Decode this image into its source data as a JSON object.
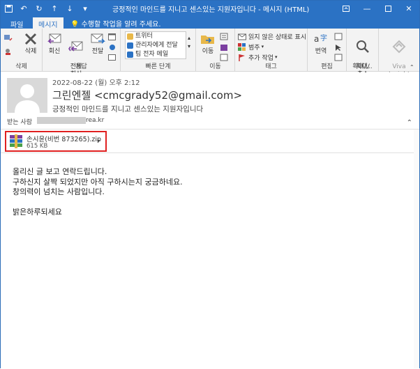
{
  "window": {
    "title": "긍정적인 마인드를 지니고 센스있는 지원자입니다 - 메시지 (HTML)"
  },
  "tabs": [
    {
      "label": "파일"
    },
    {
      "label": "메시지"
    }
  ],
  "tell_me": "수행할 작업을 알려 주세요.",
  "ribbon": {
    "delete_group": {
      "label": "삭제",
      "delete_btn": "삭제"
    },
    "respond_group": {
      "label": "응답",
      "reply": "회신",
      "reply_all": "전체\n회신",
      "forward": "전달"
    },
    "quick_steps": {
      "label": "빠른 단계",
      "items": [
        "트위터",
        "관리자에게 전달",
        "팀 전자 메일"
      ]
    },
    "move_group": {
      "label": "이동",
      "move": "이동"
    },
    "tags_group": {
      "label": "태그",
      "unread": "읽지 않은 상태로 표시",
      "categorize": "범주",
      "followup": "추가 작업"
    },
    "editing_group": {
      "label": "편집",
      "translate": "번역"
    },
    "zoom_group": {
      "label": "확대/...",
      "zoom": "확대/\n축소"
    },
    "viva": {
      "label": "Viva\nInsights"
    }
  },
  "message": {
    "date": "2022-08-22 (월) 오후 2:12",
    "sender": "그린엔젤 <cmcgrady52@gmail.com>",
    "subject": "긍정적인 마인드를 지니고 센스있는 지원자입니다",
    "to_label": "받는 사람",
    "to_value": "rea.kr"
  },
  "attachment": {
    "name": "손시윤(비번  873265).zip",
    "size": "615 KB"
  },
  "body_lines": [
    "올리신 글 보고 연락드립니다.",
    "구하신지 살짝 되었지만 아직 구하시는지 궁금하네요.",
    "창의력이 넘치는 사람입니다.",
    "밝은하루되세요"
  ]
}
